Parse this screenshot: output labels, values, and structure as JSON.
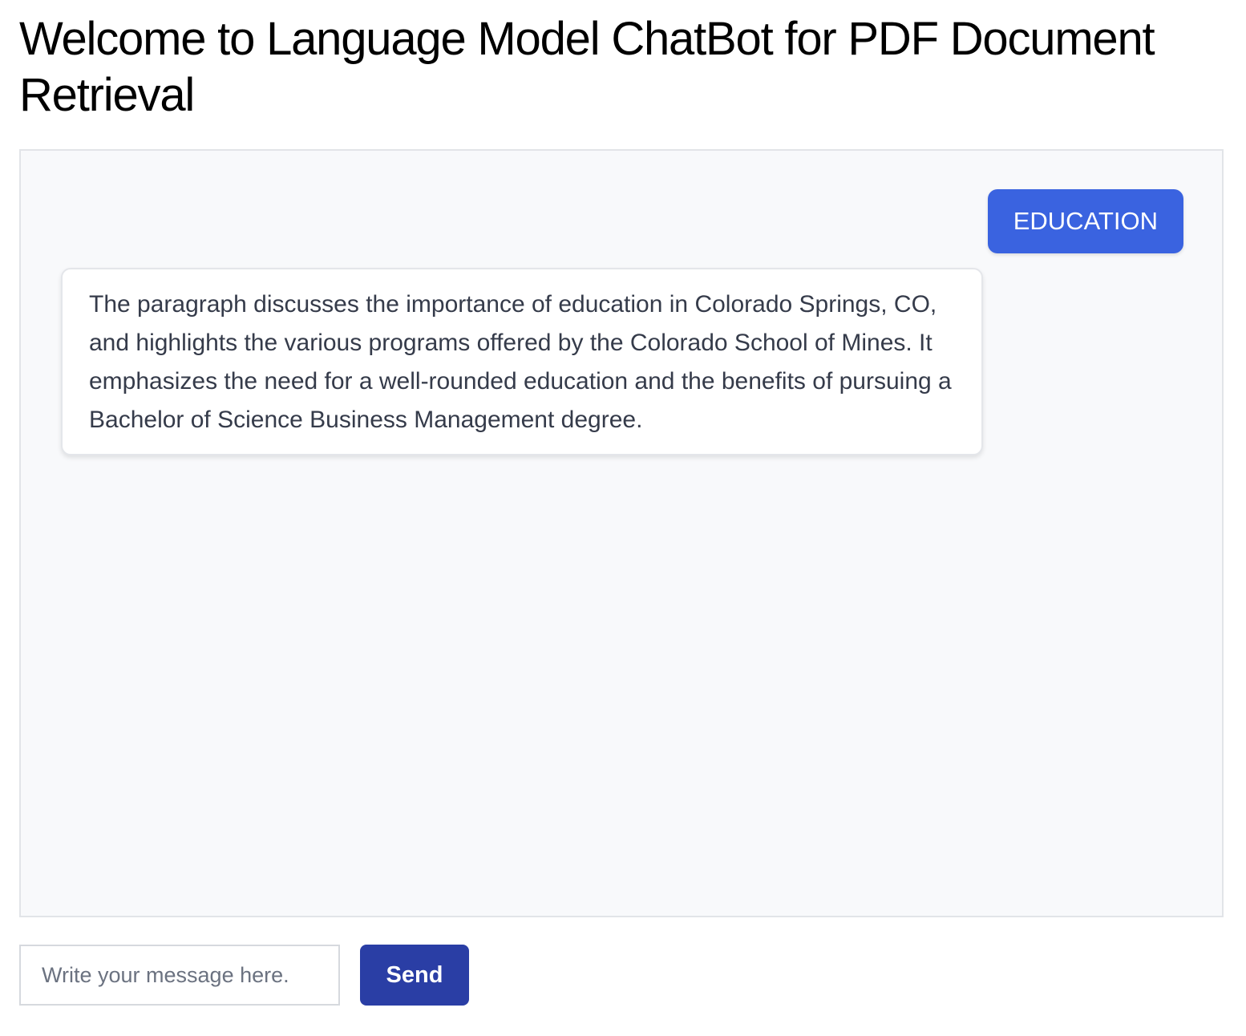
{
  "header": {
    "title": "Welcome to Language Model ChatBot for PDF Document Retrieval"
  },
  "chat": {
    "messages": [
      {
        "role": "user",
        "text": "EDUCATION"
      },
      {
        "role": "bot",
        "text": "The paragraph discusses the importance of education in Colorado Springs, CO, and highlights the various programs offered by the Colorado School of Mines. It emphasizes the need for a well-rounded education and the benefits of pursuing a Bachelor of Science Business Management degree."
      }
    ]
  },
  "composer": {
    "placeholder": "Write your message here.",
    "value": "",
    "send_label": "Send"
  },
  "colors": {
    "user_bubble": "#3a63e0",
    "send_button": "#2a3ea5",
    "panel_background": "#f8f9fb",
    "bot_text": "#353b4a"
  }
}
